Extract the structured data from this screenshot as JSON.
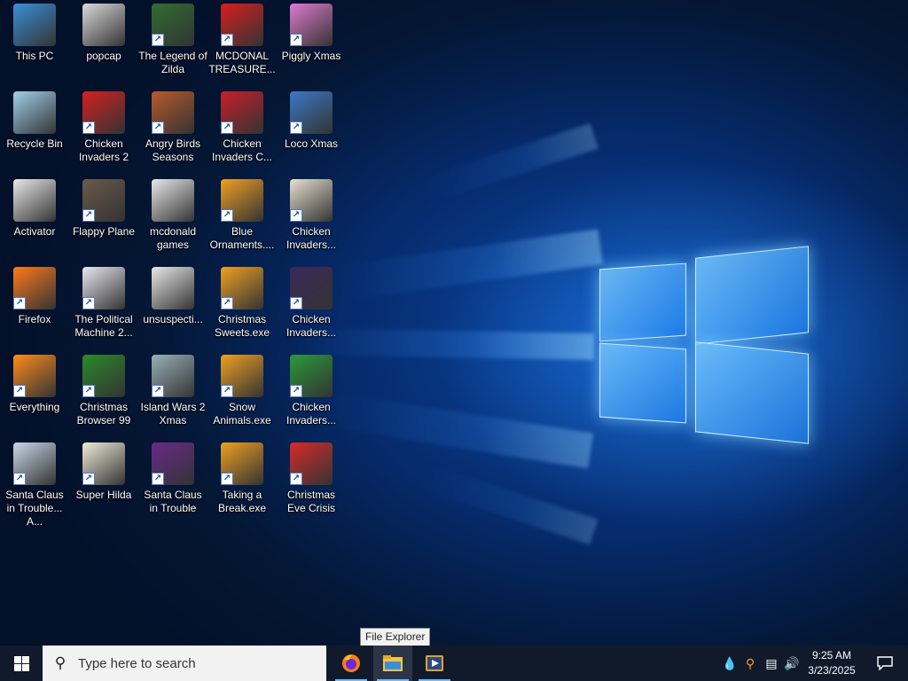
{
  "desktop": {
    "icons": [
      {
        "label": "This PC",
        "name": "this-pc",
        "shortcut": false,
        "color": "#3a8fd8"
      },
      {
        "label": "popcap",
        "name": "popcap",
        "shortcut": false,
        "color": "#d9d9d9"
      },
      {
        "label": "The Legend of Zilda",
        "name": "the-legend-of-zilda",
        "shortcut": true,
        "color": "#2f6e2f"
      },
      {
        "label": "MCDONAL TREASURE...",
        "name": "mcdonal-treasure",
        "shortcut": true,
        "color": "#d81e1e"
      },
      {
        "label": "Piggly Xmas",
        "name": "piggly-xmas",
        "shortcut": true,
        "color": "#e07ad0"
      },
      {
        "label": "Recycle Bin",
        "name": "recycle-bin",
        "shortcut": false,
        "color": "#9fd0ea"
      },
      {
        "label": "Chicken Invaders 2",
        "name": "chicken-invaders-2",
        "shortcut": true,
        "color": "#d32020"
      },
      {
        "label": "Angry Birds Seasons",
        "name": "angry-birds-seasons",
        "shortcut": true,
        "color": "#b85a2a"
      },
      {
        "label": "Chicken Invaders C...",
        "name": "chicken-invaders-c",
        "shortcut": true,
        "color": "#c81e2a"
      },
      {
        "label": "Loco Xmas",
        "name": "loco-xmas",
        "shortcut": true,
        "color": "#3a78c8"
      },
      {
        "label": "Activator",
        "name": "activator",
        "shortcut": false,
        "color": "#e8e8e8"
      },
      {
        "label": "Flappy Plane",
        "name": "flappy-plane",
        "shortcut": true,
        "color": "#6a5a4a"
      },
      {
        "label": "mcdonald games",
        "name": "mcdonald-games",
        "shortcut": false,
        "color": "#e8e8e8"
      },
      {
        "label": "Blue Ornaments....",
        "name": "blue-ornaments",
        "shortcut": true,
        "color": "#f0a020"
      },
      {
        "label": "Chicken Invaders...",
        "name": "chicken-invaders-3",
        "shortcut": true,
        "color": "#e8e0d0"
      },
      {
        "label": "Firefox",
        "name": "firefox",
        "shortcut": true,
        "color": "#ff7a1a"
      },
      {
        "label": "The Political Machine 2...",
        "name": "the-political-machine",
        "shortcut": true,
        "color": "#e8e8f0"
      },
      {
        "label": "unsuspecti...",
        "name": "unsuspecti",
        "shortcut": false,
        "color": "#e8e8e8"
      },
      {
        "label": "Christmas Sweets.exe",
        "name": "christmas-sweets",
        "shortcut": true,
        "color": "#f0a020"
      },
      {
        "label": "Chicken Invaders...",
        "name": "chicken-invaders-4",
        "shortcut": true,
        "color": "#3a2a5a"
      },
      {
        "label": "Everything",
        "name": "everything",
        "shortcut": true,
        "color": "#ff8c1a"
      },
      {
        "label": "Christmas Browser 99",
        "name": "christmas-browser-99",
        "shortcut": true,
        "color": "#2a8a2a"
      },
      {
        "label": "Island Wars 2 Xmas",
        "name": "island-wars-2-xmas",
        "shortcut": true,
        "color": "#9ab0b8"
      },
      {
        "label": "Snow Animals.exe",
        "name": "snow-animals",
        "shortcut": true,
        "color": "#f0a020"
      },
      {
        "label": "Chicken Invaders...",
        "name": "chicken-invaders-5",
        "shortcut": true,
        "color": "#2a9a3a"
      },
      {
        "label": "Santa Claus in Trouble... A...",
        "name": "santa-claus-in-trouble-a",
        "shortcut": true,
        "color": "#c8d8e8"
      },
      {
        "label": "Super Hilda",
        "name": "super-hilda",
        "shortcut": true,
        "color": "#f0ecd8"
      },
      {
        "label": "Santa Claus in Trouble",
        "name": "santa-claus-in-trouble",
        "shortcut": true,
        "color": "#6a2a8a"
      },
      {
        "label": "Taking a Break.exe",
        "name": "taking-a-break",
        "shortcut": true,
        "color": "#f0a020"
      },
      {
        "label": "Christmas Eve Crisis",
        "name": "christmas-eve-crisis",
        "shortcut": true,
        "color": "#d82a2a"
      }
    ]
  },
  "taskbar": {
    "search_placeholder": "Type here to search",
    "tooltip": "File Explorer",
    "clock_time": "9:25 AM",
    "clock_date": "3/23/2025"
  }
}
